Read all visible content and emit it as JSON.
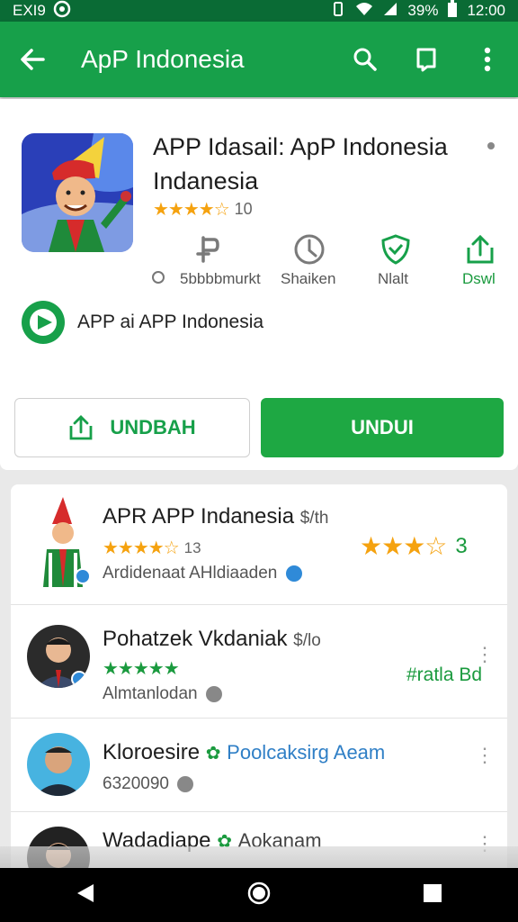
{
  "status_bar": {
    "left_text": "EXI9",
    "battery": "39%",
    "time": "12:00"
  },
  "app_bar": {
    "title": "ApP Indonesia"
  },
  "app": {
    "title": "APP Idasail: ApP Indonesia Indanesia",
    "rating_value": "10",
    "stars": "★★★★☆",
    "actions": [
      {
        "label": "5bbbbmurkt",
        "icon": "key-icon"
      },
      {
        "label": "Shaiken",
        "icon": "clock-icon"
      },
      {
        "label": "Nlalt",
        "icon": "shield-icon"
      },
      {
        "label": "Dswl",
        "icon": "share-icon"
      }
    ],
    "developer": "APP ai APP Indonesia"
  },
  "buttons": {
    "share_label": "UNDBAH",
    "install_label": "UNDUI"
  },
  "list": [
    {
      "name": "APR APP Indanesia",
      "name_suffix": "$/th",
      "stars": "★★★★☆",
      "count": "13",
      "sub": "Ardidenaat AHldiaaden",
      "right_stars": "★★★☆",
      "right_value": "3"
    },
    {
      "name": "Pohatzek Vkdaniak",
      "name_suffix": "$/lo",
      "stars": "★★★★★",
      "sub": "Almtanlodan",
      "right_text": "#ratla Bd"
    },
    {
      "name": "Kloroesire",
      "tag": "Poolcaksirg Aeam",
      "sub": "6320090"
    },
    {
      "name": "Wadadiape",
      "tag": "Aokanam",
      "sub": ""
    }
  ],
  "colors": {
    "primary": "#17a04a",
    "primary_dark": "#0a6b35",
    "install": "#1ea843",
    "star": "#f5a20f"
  }
}
